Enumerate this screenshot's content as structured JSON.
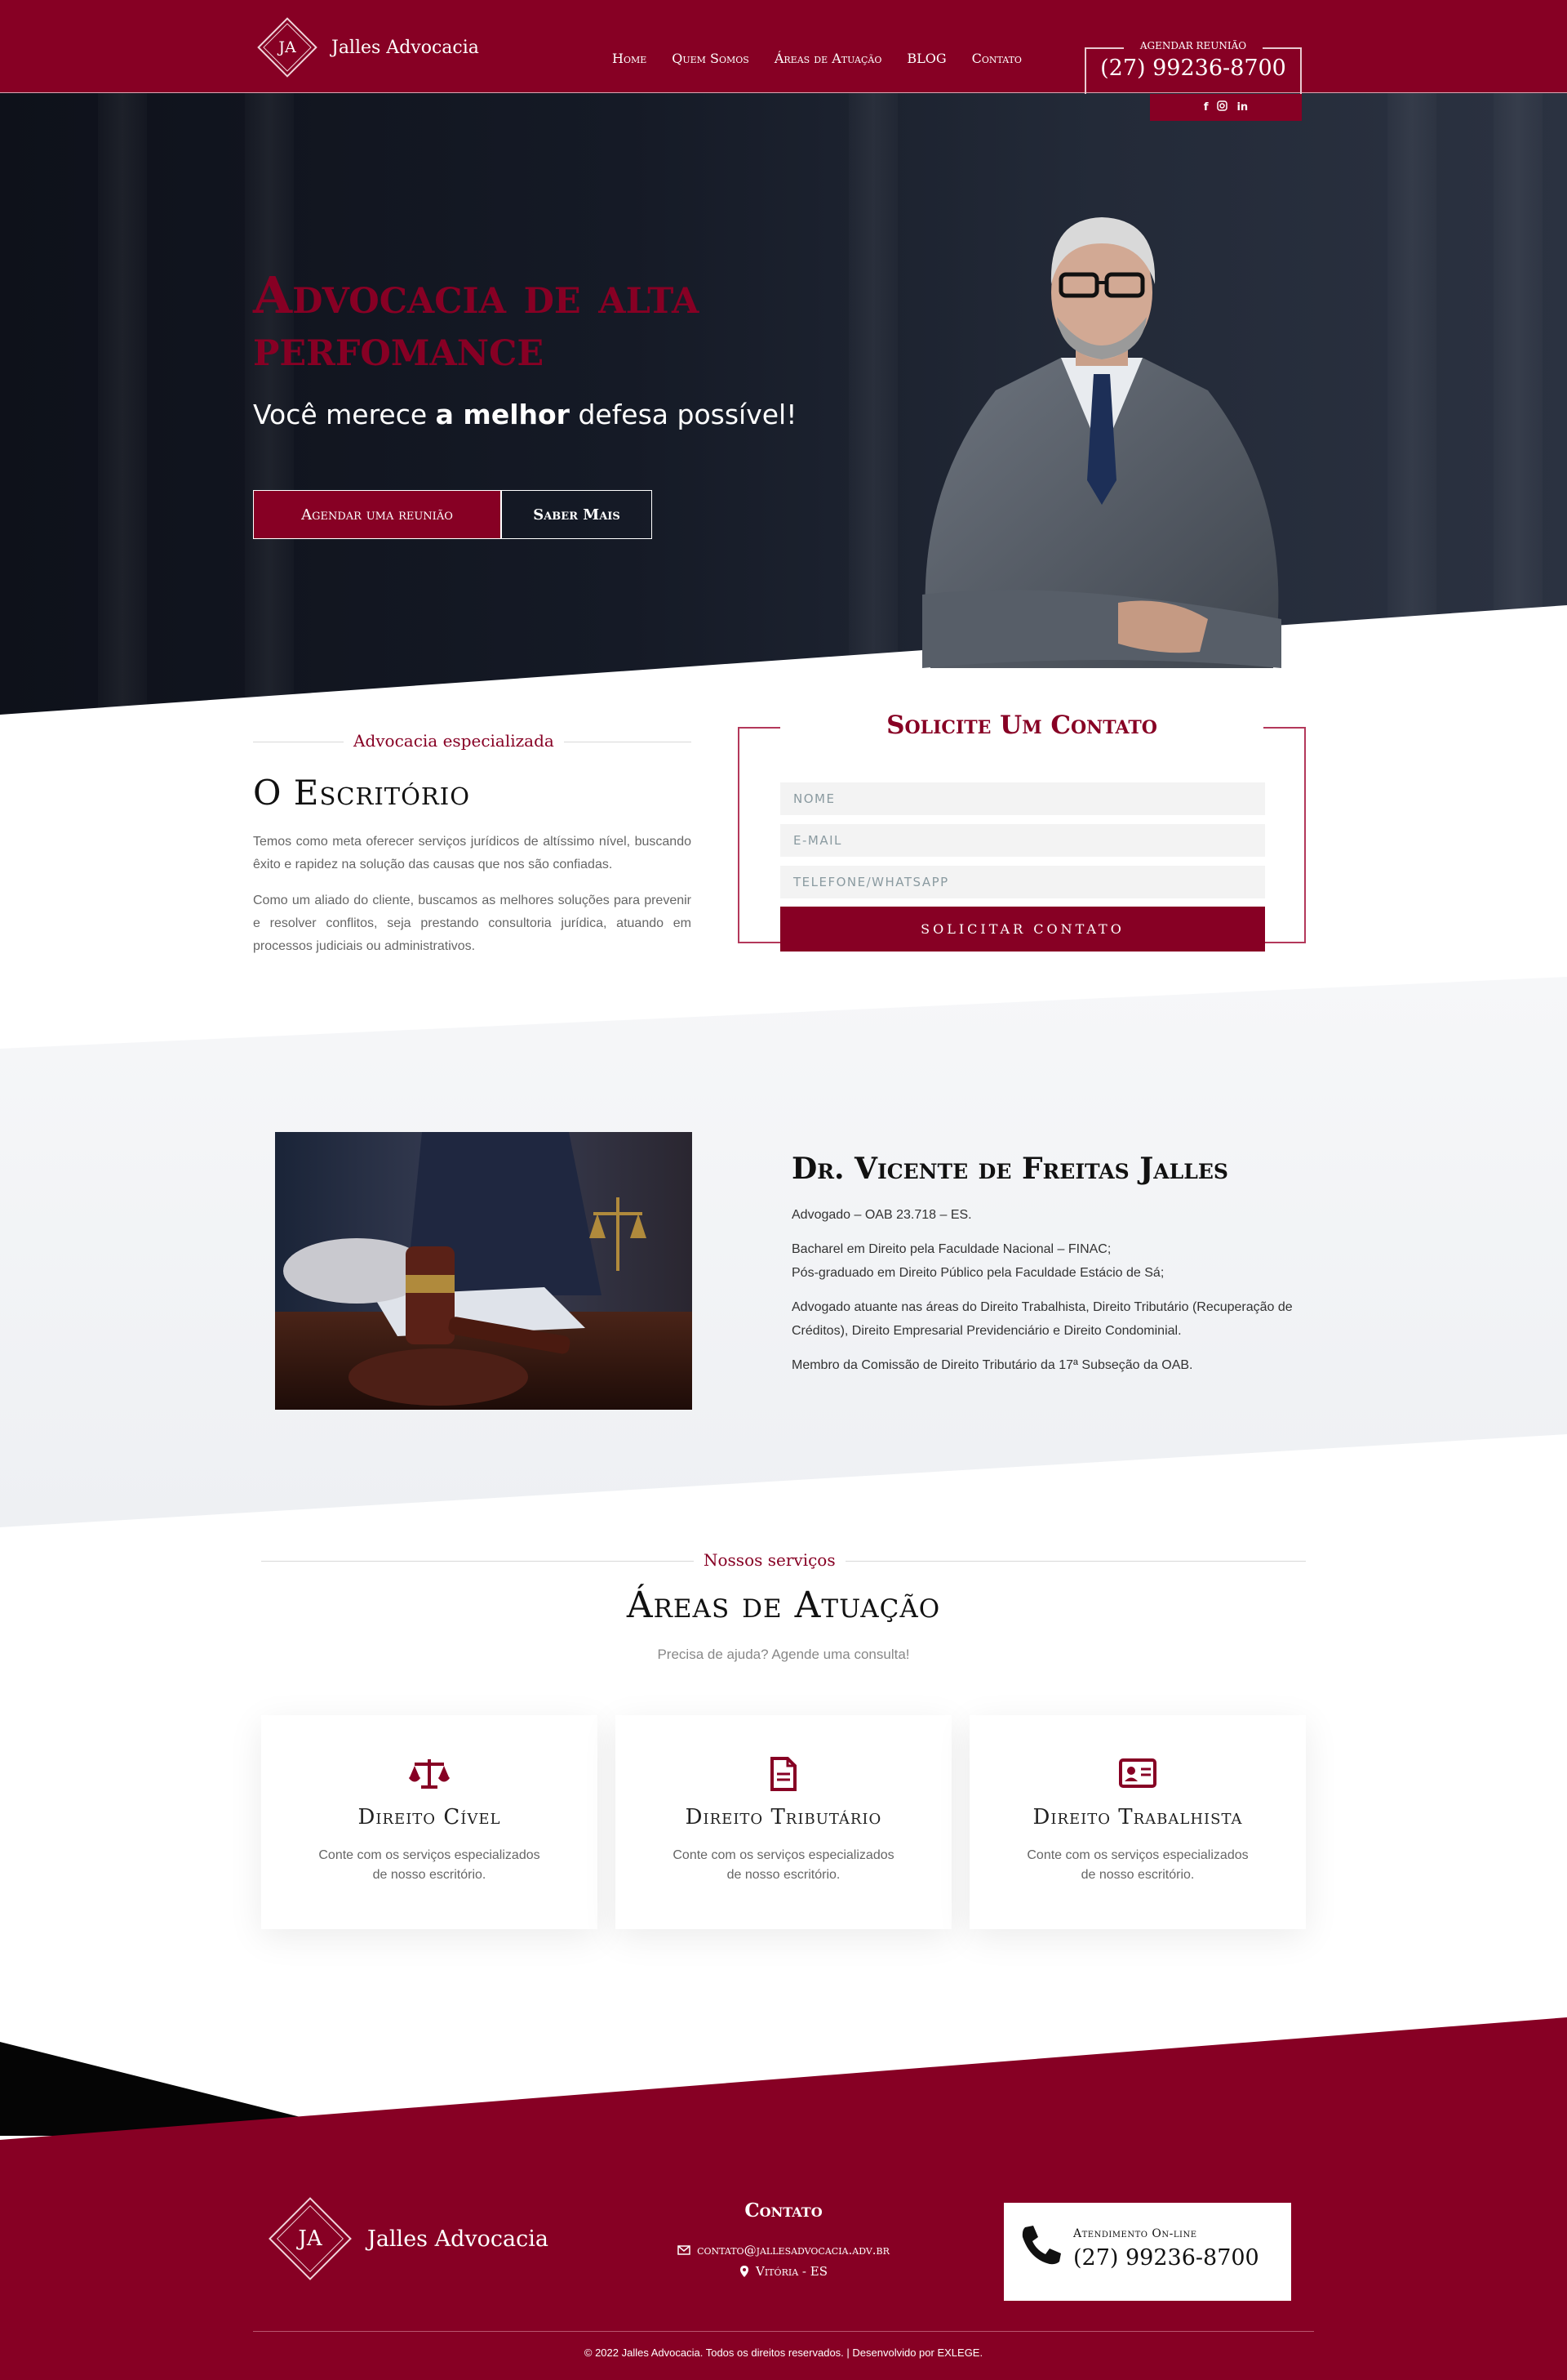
{
  "header": {
    "logo_initials": "JA",
    "logo_text": "Jalles Advocacia",
    "nav": [
      "Home",
      "Quem Somos",
      "Áreas de Atuação",
      "BLOG",
      "Contato"
    ],
    "schedule_label": "Agendar reunião",
    "phone": "(27) 99236-8700",
    "social": [
      "facebook-icon",
      "instagram-icon",
      "linkedin-icon"
    ]
  },
  "hero": {
    "title": "Advocacia de alta perfomance",
    "subtitle_pre": "Você merece ",
    "subtitle_bold": "a melhor",
    "subtitle_post": " defesa possível!",
    "btn_primary": "Agendar uma reunião",
    "btn_secondary": "Saber Mais"
  },
  "office": {
    "eyebrow": "Advocacia especializada",
    "title": "O Escritório",
    "p1": "Temos como meta oferecer serviços jurídicos de altíssimo nível, buscando êxito e rapidez na solução das causas que nos são confiadas.",
    "p2": "Como um aliado do cliente, buscamos as melhores soluções para prevenir e resolver conflitos, seja prestando consultoria jurídica, atuando em processos judiciais ou administrativos."
  },
  "form": {
    "title": "Solicite Um Contato",
    "name_placeholder": "NOME",
    "email_placeholder": "E-MAIL",
    "phone_placeholder": "TELEFONE/WHATSAPP",
    "submit": "SOLICITAR CONTATO"
  },
  "lawyer": {
    "name": "Dr. Vicente de Freitas Jalles",
    "p1": "Advogado – OAB 23.718 – ES.",
    "p2a": "Bacharel em Direito pela Faculdade Nacional – FINAC;",
    "p2b": "Pós-graduado em Direito Público pela Faculdade Estácio de Sá;",
    "p3": "Advogado atuante nas áreas do Direito Trabalhista, Direito Tributário (Recuperação de Créditos), Direito Empresarial Previdenciário e Direito Condominial.",
    "p4": "Membro da Comissão de Direito Tributário da 17ª Subseção da OAB."
  },
  "services": {
    "eyebrow": "Nossos serviços",
    "title": "Áreas de Atuação",
    "subtitle": "Precisa de ajuda? Agende uma consulta!",
    "cards": [
      {
        "icon": "scales-icon",
        "title": "Direito Cível",
        "text": "Conte com os serviços especializados de nosso escritório."
      },
      {
        "icon": "document-icon",
        "title": "Direito Tributário",
        "text": "Conte com os serviços especializados de nosso escritório."
      },
      {
        "icon": "id-card-icon",
        "title": "Direito Trabalhista",
        "text": "Conte com os serviços especializados de nosso escritório."
      }
    ]
  },
  "footer": {
    "logo_initials": "JA",
    "logo_text": "Jalles Advocacia",
    "contact_title": "Contato",
    "email": "contato@jallesadvocacia.adv.br",
    "location": "Vitória - ES",
    "online_label": "Atendimento On-line",
    "online_phone": "(27) 99236-8700",
    "copyright": "© 2022 Jalles Advocacia. Todos os direitos reservados. | Desenvolvido por EXLEGE."
  },
  "colors": {
    "brand": "#870024",
    "dark": "#151a26"
  }
}
